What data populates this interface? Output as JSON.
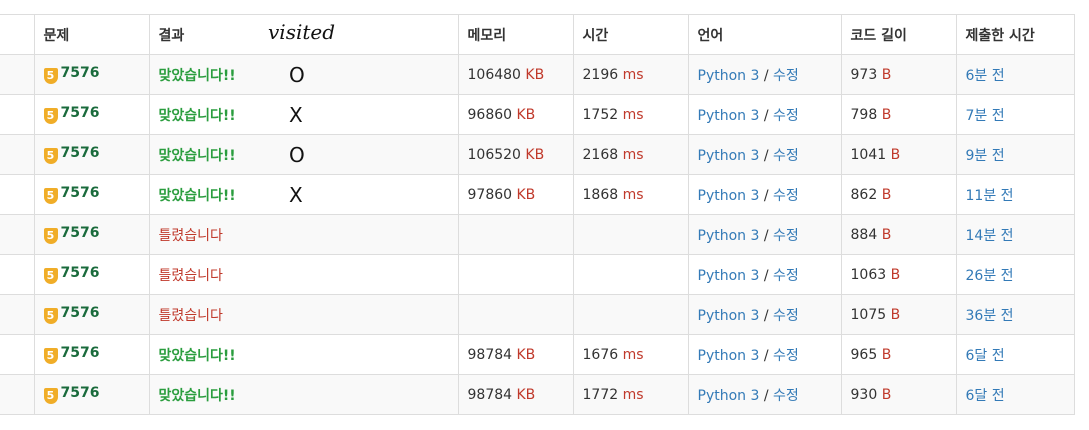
{
  "headers": [
    "",
    "문제",
    "결과",
    "메모리",
    "시간",
    "언어",
    "코드 길이",
    "제출한 시간"
  ],
  "annotation": {
    "header_note": "visited"
  },
  "tier_badge": "5",
  "rows": [
    {
      "problem": "7576",
      "result": "맞았습니다!!",
      "result_type": "ac",
      "mark": "O",
      "memory": "106480",
      "memory_unit": "KB",
      "time": "2196",
      "time_unit": "ms",
      "language": "Python 3",
      "edit": "수정",
      "code_len": "973",
      "code_unit": "B",
      "submitted": "6분 전"
    },
    {
      "problem": "7576",
      "result": "맞았습니다!!",
      "result_type": "ac",
      "mark": "X",
      "memory": "96860",
      "memory_unit": "KB",
      "time": "1752",
      "time_unit": "ms",
      "language": "Python 3",
      "edit": "수정",
      "code_len": "798",
      "code_unit": "B",
      "submitted": "7분 전"
    },
    {
      "problem": "7576",
      "result": "맞았습니다!!",
      "result_type": "ac",
      "mark": "O",
      "memory": "106520",
      "memory_unit": "KB",
      "time": "2168",
      "time_unit": "ms",
      "language": "Python 3",
      "edit": "수정",
      "code_len": "1041",
      "code_unit": "B",
      "submitted": "9분 전"
    },
    {
      "problem": "7576",
      "result": "맞았습니다!!",
      "result_type": "ac",
      "mark": "X",
      "memory": "97860",
      "memory_unit": "KB",
      "time": "1868",
      "time_unit": "ms",
      "language": "Python 3",
      "edit": "수정",
      "code_len": "862",
      "code_unit": "B",
      "submitted": "11분 전"
    },
    {
      "problem": "7576",
      "result": "틀렸습니다",
      "result_type": "wa",
      "mark": "",
      "memory": "",
      "memory_unit": "",
      "time": "",
      "time_unit": "",
      "language": "Python 3",
      "edit": "수정",
      "code_len": "884",
      "code_unit": "B",
      "submitted": "14분 전"
    },
    {
      "problem": "7576",
      "result": "틀렸습니다",
      "result_type": "wa",
      "mark": "",
      "memory": "",
      "memory_unit": "",
      "time": "",
      "time_unit": "",
      "language": "Python 3",
      "edit": "수정",
      "code_len": "1063",
      "code_unit": "B",
      "submitted": "26분 전"
    },
    {
      "problem": "7576",
      "result": "틀렸습니다",
      "result_type": "wa",
      "mark": "",
      "memory": "",
      "memory_unit": "",
      "time": "",
      "time_unit": "",
      "language": "Python 3",
      "edit": "수정",
      "code_len": "1075",
      "code_unit": "B",
      "submitted": "36분 전"
    },
    {
      "problem": "7576",
      "result": "맞았습니다!!",
      "result_type": "ac",
      "mark": "",
      "memory": "98784",
      "memory_unit": "KB",
      "time": "1676",
      "time_unit": "ms",
      "language": "Python 3",
      "edit": "수정",
      "code_len": "965",
      "code_unit": "B",
      "submitted": "6달 전"
    },
    {
      "problem": "7576",
      "result": "맞았습니다!!",
      "result_type": "ac",
      "mark": "",
      "memory": "98784",
      "memory_unit": "KB",
      "time": "1772",
      "time_unit": "ms",
      "language": "Python 3",
      "edit": "수정",
      "code_len": "930",
      "code_unit": "B",
      "submitted": "6달 전"
    }
  ]
}
